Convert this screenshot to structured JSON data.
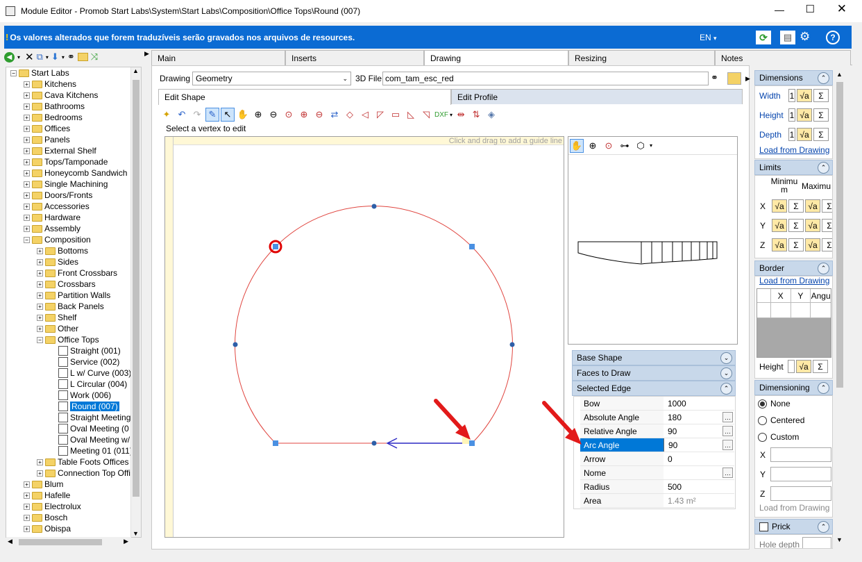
{
  "window": {
    "title": "Module Editor - Promob Start Labs\\System\\Start Labs\\Composition\\Office Tops\\Round (007)"
  },
  "banner": {
    "message": "Os valores alterados que forem traduzíveis serão gravados nos arquivos de resources.",
    "lang": "EN",
    "lang_arrow": "▾",
    "bg_color": "#0b6bd3"
  },
  "main_tabs": [
    {
      "label": "Main"
    },
    {
      "label": "Inserts"
    },
    {
      "label": "Drawing"
    },
    {
      "label": "Resizing"
    },
    {
      "label": "Notes"
    }
  ],
  "drawing_bar": {
    "drawing_label": "Drawing",
    "drawing_value": "Geometry",
    "file_label": "3D File",
    "file_value": "com_tam_esc_red"
  },
  "sub_tabs": [
    {
      "label": "Edit Shape"
    },
    {
      "label": "Edit Profile"
    }
  ],
  "status_hint": "Select a vertex to edit",
  "canvas_hint": "Click and drag to add a guide line",
  "tree": [
    {
      "label": "Start Labs",
      "level": 0,
      "expand": "−",
      "type": "folder"
    },
    {
      "label": "Kitchens",
      "level": 1,
      "expand": "+",
      "type": "folder"
    },
    {
      "label": "Cava Kitchens",
      "level": 1,
      "expand": "+",
      "type": "folder"
    },
    {
      "label": "Bathrooms",
      "level": 1,
      "expand": "+",
      "type": "folder"
    },
    {
      "label": "Bedrooms",
      "level": 1,
      "expand": "+",
      "type": "folder"
    },
    {
      "label": "Offices",
      "level": 1,
      "expand": "+",
      "type": "folder"
    },
    {
      "label": "Panels",
      "level": 1,
      "expand": "+",
      "type": "folder"
    },
    {
      "label": "External Shelf",
      "level": 1,
      "expand": "+",
      "type": "folder"
    },
    {
      "label": "Tops/Tamponade",
      "level": 1,
      "expand": "+",
      "type": "folder"
    },
    {
      "label": "Honeycomb Sandwich",
      "level": 1,
      "expand": "+",
      "type": "folder"
    },
    {
      "label": "Single Machining",
      "level": 1,
      "expand": "+",
      "type": "folder"
    },
    {
      "label": "Doors/Fronts",
      "level": 1,
      "expand": "+",
      "type": "folder"
    },
    {
      "label": "Accessories",
      "level": 1,
      "expand": "+",
      "type": "folder"
    },
    {
      "label": "Hardware",
      "level": 1,
      "expand": "+",
      "type": "folder"
    },
    {
      "label": "Assembly",
      "level": 1,
      "expand": "+",
      "type": "folder"
    },
    {
      "label": "Composition",
      "level": 1,
      "expand": "−",
      "type": "folder"
    },
    {
      "label": "Bottoms",
      "level": 2,
      "expand": "+",
      "type": "folder"
    },
    {
      "label": "Sides",
      "level": 2,
      "expand": "+",
      "type": "folder"
    },
    {
      "label": "Front Crossbars",
      "level": 2,
      "expand": "+",
      "type": "folder"
    },
    {
      "label": "Crossbars",
      "level": 2,
      "expand": "+",
      "type": "folder"
    },
    {
      "label": "Partition Walls",
      "level": 2,
      "expand": "+",
      "type": "folder"
    },
    {
      "label": "Back Panels",
      "level": 2,
      "expand": "+",
      "type": "folder"
    },
    {
      "label": "Shelf",
      "level": 2,
      "expand": "+",
      "type": "folder"
    },
    {
      "label": "Other",
      "level": 2,
      "expand": "+",
      "type": "folder"
    },
    {
      "label": "Office Tops",
      "level": 2,
      "expand": "−",
      "type": "folder"
    },
    {
      "label": "Straight (001)",
      "level": 3,
      "expand": "",
      "type": "doc"
    },
    {
      "label": "Service (002)",
      "level": 3,
      "expand": "",
      "type": "doc"
    },
    {
      "label": "L w/ Curve (003)",
      "level": 3,
      "expand": "",
      "type": "doc"
    },
    {
      "label": "L Circular (004)",
      "level": 3,
      "expand": "",
      "type": "doc"
    },
    {
      "label": "Work (006)",
      "level": 3,
      "expand": "",
      "type": "doc"
    },
    {
      "label": "Round (007)",
      "level": 3,
      "expand": "",
      "type": "doc",
      "selected": true
    },
    {
      "label": "Straight Meeting",
      "level": 3,
      "expand": "",
      "type": "doc"
    },
    {
      "label": "Oval Meeting (0",
      "level": 3,
      "expand": "",
      "type": "doc"
    },
    {
      "label": "Oval Meeting w/",
      "level": 3,
      "expand": "",
      "type": "doc"
    },
    {
      "label": "Meeting 01 (011)",
      "level": 3,
      "expand": "",
      "type": "doc"
    },
    {
      "label": "Table Foots Offices",
      "level": 2,
      "expand": "+",
      "type": "folder"
    },
    {
      "label": "Connection Top Offi",
      "level": 2,
      "expand": "+",
      "type": "folder"
    },
    {
      "label": "Blum",
      "level": 1,
      "expand": "+",
      "type": "folder"
    },
    {
      "label": "Hafelle",
      "level": 1,
      "expand": "+",
      "type": "folder"
    },
    {
      "label": "Electrolux",
      "level": 1,
      "expand": "+",
      "type": "folder"
    },
    {
      "label": "Bosch",
      "level": 1,
      "expand": "+",
      "type": "folder"
    },
    {
      "label": "Obispa",
      "level": 1,
      "expand": "+",
      "type": "folder"
    }
  ],
  "panels": {
    "base_shape": "Base Shape",
    "faces_to_draw": "Faces to Draw",
    "selected_edge": "Selected Edge"
  },
  "edge_props": [
    {
      "label": "Bow",
      "value": "1000",
      "dots": false
    },
    {
      "label": "Absolute Angle",
      "value": "180",
      "dots": true
    },
    {
      "label": "Relative Angle",
      "value": "90",
      "dots": true
    },
    {
      "label": "Arc Angle",
      "value": "90",
      "dots": true,
      "selected": true
    },
    {
      "label": "Arrow",
      "value": "0",
      "dots": false
    },
    {
      "label": "Nome",
      "value": "",
      "dots": true
    },
    {
      "label": "Radius",
      "value": "500",
      "dots": false
    },
    {
      "label": "Area",
      "value": "1.43 m²",
      "dots": false,
      "dim": true
    }
  ],
  "right": {
    "dimensions": "Dimensions",
    "width": "Width",
    "height": "Height",
    "depth": "Depth",
    "dim_value": "1",
    "load_from_drawing": "Load from Drawing",
    "limits": "Limits",
    "minimum": "Minimum",
    "maximum": "Maximu",
    "x": "X",
    "y": "Y",
    "z": "Z",
    "border": "Border",
    "border_cols": [
      "X",
      "Y",
      "Angu"
    ],
    "border_height": "Height",
    "dimensioning": "Dimensioning",
    "none": "None",
    "centered": "Centered",
    "custom": "Custom",
    "prick": "Prick",
    "hole_depth": "Hole depth",
    "sqrt_icon": "√a",
    "sigma_icon": "Σ"
  }
}
